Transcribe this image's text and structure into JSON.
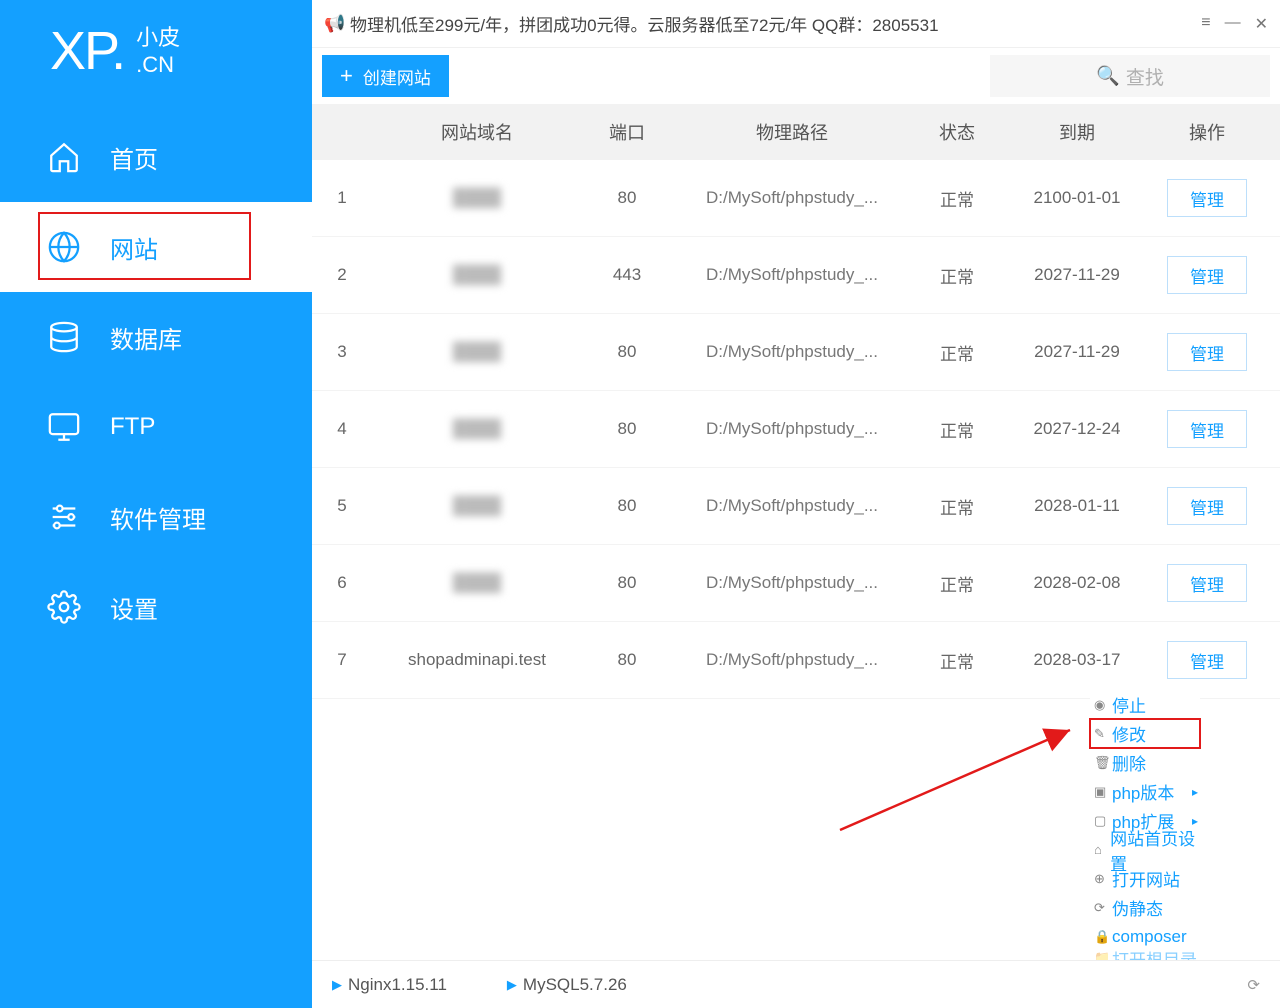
{
  "logo": {
    "main": "XP.",
    "sub1": "小皮",
    "sub2": ".CN"
  },
  "nav": {
    "home": "首页",
    "website": "网站",
    "database": "数据库",
    "ftp": "FTP",
    "software": "软件管理",
    "settings": "设置"
  },
  "titlebar": "物理机低至299元/年，拼团成功0元得。云服务器低至72元/年  QQ群：2805531",
  "toolbar": {
    "create": "创建网站",
    "search_placeholder": "查找"
  },
  "columns": {
    "domain": "网站域名",
    "port": "端口",
    "path": "物理路径",
    "status": "状态",
    "expire": "到期",
    "action": "操作"
  },
  "rows": [
    {
      "idx": "1",
      "domain": "████",
      "port": "80",
      "path": "D:/MySoft/phpstudy_...",
      "status": "正常",
      "expire": "2100-01-01",
      "action": "管理"
    },
    {
      "idx": "2",
      "domain": "████",
      "port": "443",
      "path": "D:/MySoft/phpstudy_...",
      "status": "正常",
      "expire": "2027-11-29",
      "action": "管理"
    },
    {
      "idx": "3",
      "domain": "████",
      "port": "80",
      "path": "D:/MySoft/phpstudy_...",
      "status": "正常",
      "expire": "2027-11-29",
      "action": "管理"
    },
    {
      "idx": "4",
      "domain": "████",
      "port": "80",
      "path": "D:/MySoft/phpstudy_...",
      "status": "正常",
      "expire": "2027-12-24",
      "action": "管理"
    },
    {
      "idx": "5",
      "domain": "████",
      "port": "80",
      "path": "D:/MySoft/phpstudy_...",
      "status": "正常",
      "expire": "2028-01-11",
      "action": "管理"
    },
    {
      "idx": "6",
      "domain": "████",
      "port": "80",
      "path": "D:/MySoft/phpstudy_...",
      "status": "正常",
      "expire": "2028-02-08",
      "action": "管理"
    },
    {
      "idx": "7",
      "domain": "shopadminapi.test",
      "port": "80",
      "path": "D:/MySoft/phpstudy_...",
      "status": "正常",
      "expire": "2028-03-17",
      "action": "管理"
    }
  ],
  "context_menu": {
    "stop": "停止",
    "edit": "修改",
    "delete": "删除",
    "php_version": "php版本",
    "php_ext": "php扩展",
    "homepage": "网站首页设置",
    "open": "打开网站",
    "pseudo_static": "伪静态",
    "composer": "composer",
    "open_dir": "打开根目录"
  },
  "statusbar": {
    "nginx": "Nginx1.15.11",
    "mysql": "MySQL5.7.26"
  }
}
